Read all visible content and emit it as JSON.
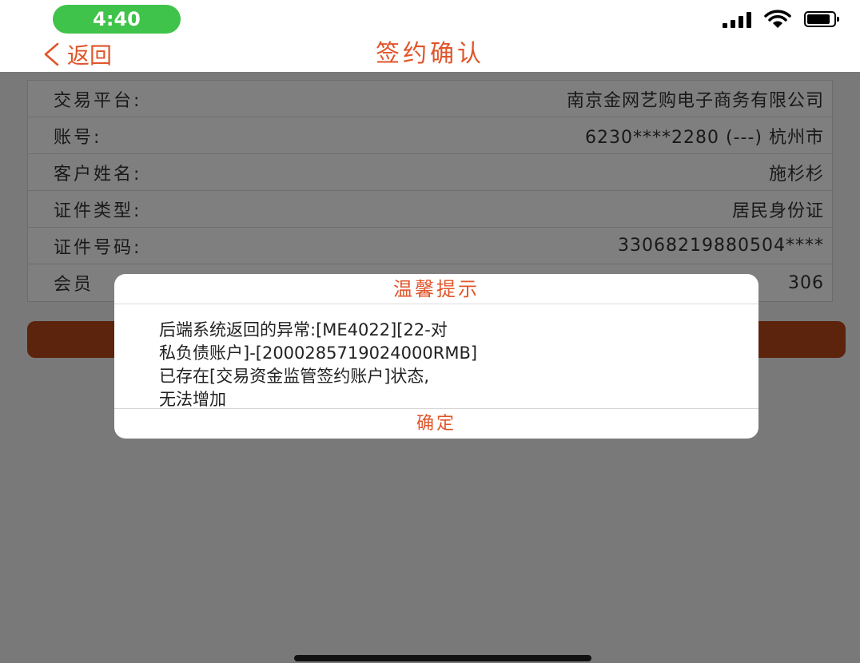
{
  "status_bar": {
    "time": "4:40",
    "signal_icon": "signal-bars-icon",
    "wifi_icon": "wifi-icon",
    "battery_icon": "battery-icon",
    "time_pill_color": "#3fc34a"
  },
  "nav": {
    "back_label": "返回",
    "back_icon": "chevron-left-icon",
    "title": "签约确认",
    "accent_color": "#e0552a"
  },
  "info_rows": [
    {
      "label": "交易平台:",
      "value": "南京金网艺购电子商务有限公司"
    },
    {
      "label": "账号:",
      "value": "6230****2280 (---) 杭州市"
    },
    {
      "label": "客户姓名:",
      "value": "施杉杉"
    },
    {
      "label": "证件类型:",
      "value": "居民身份证"
    },
    {
      "label": "证件号码:",
      "value": "33068219880504****"
    },
    {
      "label": "会员",
      "value": "306"
    }
  ],
  "dialog": {
    "title": "温馨提示",
    "message": "后端系统返回的异常:[ME4022][22-对\n私负债账户]-[2000285719024000RMB]\n已存在[交易资金监管签约账户]状态,\n无法增加",
    "ok_label": "确定"
  }
}
